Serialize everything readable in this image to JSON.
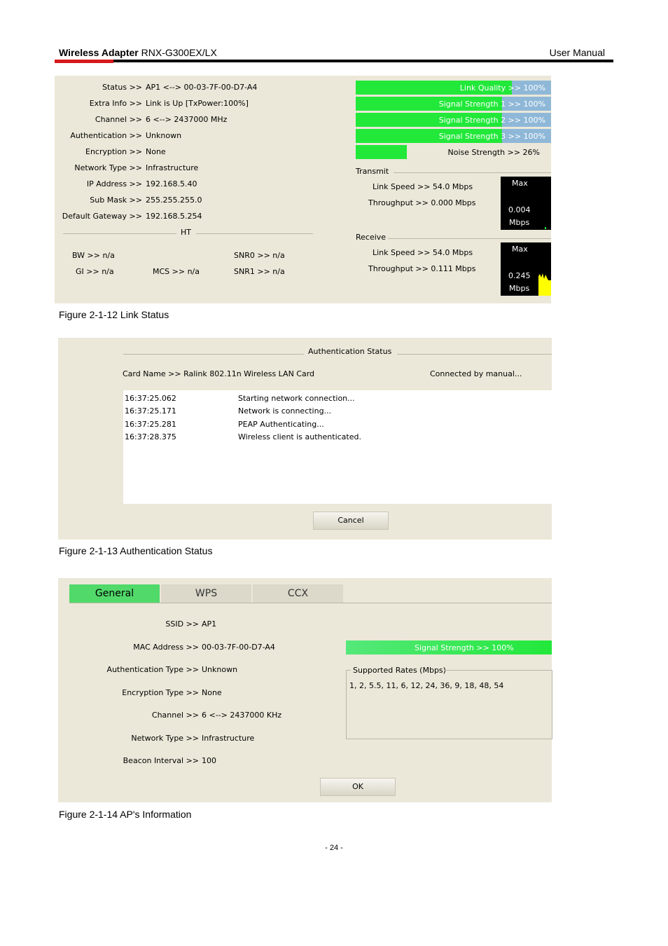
{
  "header": {
    "product_bold": "Wireless Adapter",
    "product_model": "RNX-G300EX/LX",
    "manual_label": "User Manual"
  },
  "fig12": {
    "rows": [
      {
        "label": "Status >>",
        "value": "AP1 <--> 00-03-7F-00-D7-A4"
      },
      {
        "label": "Extra Info >>",
        "value": "Link is Up [TxPower:100%]"
      },
      {
        "label": "Channel >>",
        "value": "6 <--> 2437000 MHz"
      },
      {
        "label": "Authentication >>",
        "value": "Unknown"
      },
      {
        "label": "Encryption >>",
        "value": "None"
      },
      {
        "label": "Network Type >>",
        "value": "Infrastructure"
      },
      {
        "label": "IP Address >>",
        "value": "192.168.5.40"
      },
      {
        "label": "Sub Mask >>",
        "value": "255.255.255.0"
      },
      {
        "label": "Default Gateway >>",
        "value": "192.168.5.254"
      }
    ],
    "ht_label": "HT",
    "bw": "BW >> n/a",
    "gi": "GI >> n/a",
    "mcs": "MCS >> n/a",
    "snr0": "SNR0 >> n/a",
    "snr1": "SNR1 >> n/a",
    "bars": [
      {
        "text": "Link Quality >> 100%",
        "level": 0.8
      },
      {
        "text": "Signal Strength 1 >> 100%",
        "level": 0.75
      },
      {
        "text": "Signal Strength 2 >> 100%",
        "level": 0.75
      },
      {
        "text": "Signal Strength 3 >> 100%",
        "level": 0.75
      }
    ],
    "noise": {
      "text": "Noise Strength >> 26%",
      "level": 0.26
    },
    "transmit": {
      "title": "Transmit",
      "link_speed": "Link Speed >>  54.0 Mbps",
      "throughput": "Throughput >>  0.000 Mbps",
      "graph_max": "Max",
      "graph_value": "0.004",
      "graph_unit": "Mbps"
    },
    "receive": {
      "title": "Receive",
      "link_speed": "Link Speed >>  54.0 Mbps",
      "throughput": "Throughput >>  0.111 Mbps",
      "graph_max": "Max",
      "graph_value": "0.245",
      "graph_unit": "Mbps"
    },
    "caption": "Figure 2-1-12 Link Status"
  },
  "fig13": {
    "title": "Authentication Status",
    "card_name": "Card Name >> Ralink 802.11n Wireless LAN Card",
    "connected": "Connected by manual...",
    "log": [
      {
        "time": "16:37:25.062",
        "msg": "Starting network connection..."
      },
      {
        "time": "16:37:25.171",
        "msg": "Network is connecting..."
      },
      {
        "time": "16:37:25.281",
        "msg": "PEAP Authenticating..."
      },
      {
        "time": "16:37:28.375",
        "msg": "Wireless client is authenticated."
      }
    ],
    "cancel": "Cancel",
    "caption": "Figure 2-1-13 Authentication Status"
  },
  "fig14": {
    "tabs": [
      "General",
      "WPS",
      "CCX"
    ],
    "rows": [
      {
        "label": "SSID >>",
        "value": "AP1"
      },
      {
        "label": "MAC Address >>",
        "value": "00-03-7F-00-D7-A4"
      },
      {
        "label": "Authentication Type >>",
        "value": "Unknown"
      },
      {
        "label": "Encryption Type >>",
        "value": "None"
      },
      {
        "label": "Channel >>",
        "value": "6 <--> 2437000 KHz"
      },
      {
        "label": "Network Type >>",
        "value": "Infrastructure"
      },
      {
        "label": "Beacon Interval >>",
        "value": "100"
      }
    ],
    "signal": {
      "text": "Signal Strength >> 100%",
      "level": 1.0
    },
    "rates_title": "Supported Rates (Mbps)",
    "rates": "1, 2, 5.5, 11, 6, 12, 24, 36, 9, 18, 48, 54",
    "ok": "OK",
    "caption": "Figure 2-1-14 AP's Information"
  },
  "page_number": "- 24 -",
  "colors": {
    "panel": "#ebe8d9",
    "green": "#22e83a",
    "blue": "#8fb8d8",
    "red_rule": "#d7191c"
  }
}
